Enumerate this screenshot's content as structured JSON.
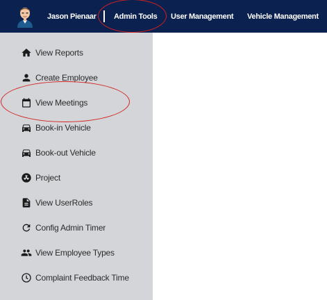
{
  "header": {
    "user_name": "Jason Pienaar",
    "nav": [
      {
        "label": "Admin Tools"
      },
      {
        "label": "User Management"
      },
      {
        "label": "Vehicle Management"
      }
    ]
  },
  "sidebar": {
    "items": [
      {
        "label": "View Reports",
        "icon": "home-icon"
      },
      {
        "label": "Create Employee",
        "icon": "person-icon"
      },
      {
        "label": "View Meetings",
        "icon": "calendar-icon"
      },
      {
        "label": "Book-in Vehicle",
        "icon": "car-icon"
      },
      {
        "label": "Book-out Vehicle",
        "icon": "car-icon"
      },
      {
        "label": "Project",
        "icon": "radiation-icon"
      },
      {
        "label": "View UserRoles",
        "icon": "document-icon"
      },
      {
        "label": "Config Admin Timer",
        "icon": "refresh-icon"
      },
      {
        "label": "View Employee Types",
        "icon": "people-icon"
      },
      {
        "label": "Complaint Feedback Time",
        "icon": "clock-icon"
      }
    ]
  },
  "colors": {
    "header_bg": "#0b2150",
    "sidebar_bg": "#d3d5d8",
    "annotation": "#d42020"
  }
}
